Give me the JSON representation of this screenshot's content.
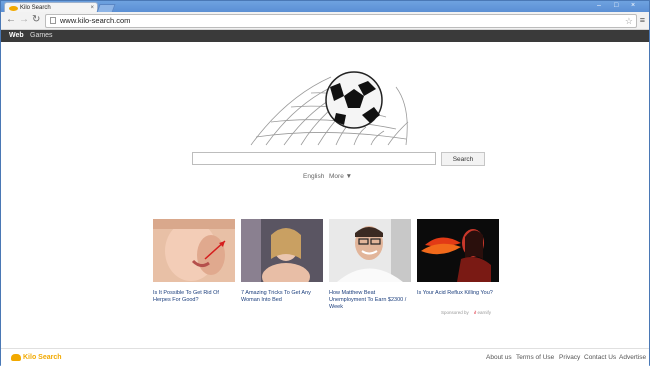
{
  "browser": {
    "tab_title": "Kilo Search",
    "tab_close": "×",
    "url": "www.kilo-search.com",
    "window_controls": [
      "–",
      "□",
      "×"
    ]
  },
  "site_nav": {
    "items": [
      "Web",
      "Games"
    ]
  },
  "search": {
    "button_label": "Search",
    "input_value": "",
    "language": "English",
    "more": "More ▼"
  },
  "ads": [
    {
      "caption": "Is It Possible To Get Rid Of Herpes For Good?"
    },
    {
      "caption": "7 Amazing Tricks To Get Any Woman Into Bed"
    },
    {
      "caption": "How Matthew Beat Unemployment To Earn $2300 / Week"
    },
    {
      "caption": "Is Your Acid Reflux Killing You?"
    }
  ],
  "sponsored": {
    "text": "Sponsored by",
    "brand": "earnify"
  },
  "footer": {
    "logo_text": "Kilo Search",
    "links": [
      "About us",
      "Terms of Use",
      "Privacy",
      "Contact Us",
      "Advertise"
    ]
  },
  "colors": {
    "nav_bar": "#3a3a3a",
    "brand": "#f2a900",
    "frame": "#6d9ad3"
  }
}
